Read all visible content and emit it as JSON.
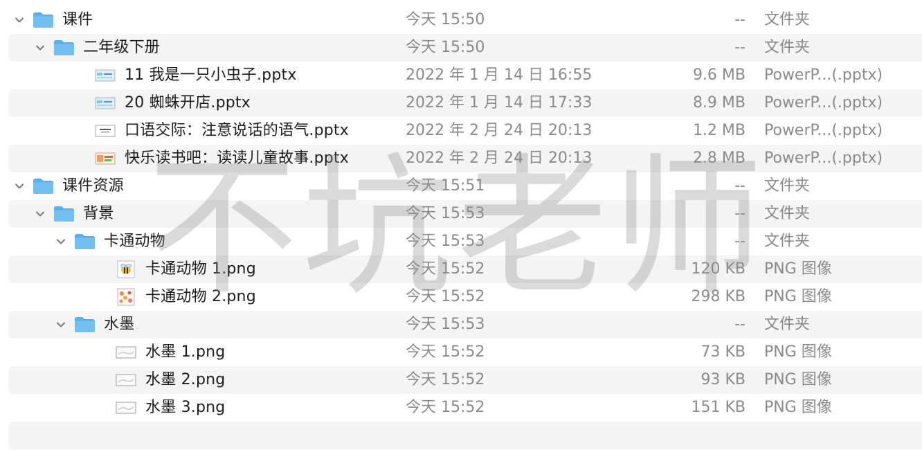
{
  "watermark": "不坑老师",
  "rows": [
    {
      "depth": 0,
      "type": "folder",
      "expanded": true,
      "name": "课件",
      "date": "今天 15:50",
      "size": "--",
      "kind": "文件夹"
    },
    {
      "depth": 1,
      "type": "folder",
      "expanded": true,
      "name": "二年级下册",
      "date": "今天 15:50",
      "size": "--",
      "kind": "文件夹"
    },
    {
      "depth": 2,
      "type": "file",
      "thumb": "pptx-blue",
      "name": "11 我是一只小虫子.pptx",
      "date": "2022 年 1 月 14 日 16:55",
      "size": "9.6 MB",
      "kind": "PowerP...(.pptx)"
    },
    {
      "depth": 2,
      "type": "file",
      "thumb": "pptx-blue",
      "name": "20 蜘蛛开店.pptx",
      "date": "2022 年 1 月 14 日 17:33",
      "size": "8.9 MB",
      "kind": "PowerP...(.pptx)"
    },
    {
      "depth": 2,
      "type": "file",
      "thumb": "pptx-white",
      "name": "口语交际：注意说话的语气.pptx",
      "date": "2022 年 2 月 24 日 20:13",
      "size": "1.2 MB",
      "kind": "PowerP...(.pptx)"
    },
    {
      "depth": 2,
      "type": "file",
      "thumb": "pptx-colorful",
      "name": "快乐读书吧：读读儿童故事.pptx",
      "date": "2022 年 2 月 24 日 20:13",
      "size": "2.8 MB",
      "kind": "PowerP...(.pptx)"
    },
    {
      "depth": 0,
      "type": "folder",
      "expanded": true,
      "name": "课件资源",
      "date": "今天 15:51",
      "size": "--",
      "kind": "文件夹"
    },
    {
      "depth": 1,
      "type": "folder",
      "expanded": true,
      "name": "背景",
      "date": "今天 15:53",
      "size": "--",
      "kind": "文件夹"
    },
    {
      "depth": 2,
      "type": "folder",
      "expanded": true,
      "name": "卡通动物",
      "date": "今天 15:53",
      "size": "--",
      "kind": "文件夹"
    },
    {
      "depth": 3,
      "type": "file",
      "thumb": "png-bee",
      "name": "卡通动物 1.png",
      "date": "今天 15:52",
      "size": "120 KB",
      "kind": "PNG 图像"
    },
    {
      "depth": 3,
      "type": "file",
      "thumb": "png-animals",
      "name": "卡通动物 2.png",
      "date": "今天 15:52",
      "size": "298 KB",
      "kind": "PNG 图像"
    },
    {
      "depth": 2,
      "type": "folder",
      "expanded": true,
      "name": "水墨",
      "date": "今天 15:53",
      "size": "--",
      "kind": "文件夹"
    },
    {
      "depth": 3,
      "type": "file",
      "thumb": "png-ink",
      "name": "水墨 1.png",
      "date": "今天 15:52",
      "size": "73 KB",
      "kind": "PNG 图像"
    },
    {
      "depth": 3,
      "type": "file",
      "thumb": "png-ink",
      "name": "水墨 2.png",
      "date": "今天 15:52",
      "size": "93 KB",
      "kind": "PNG 图像"
    },
    {
      "depth": 3,
      "type": "file",
      "thumb": "png-ink",
      "name": "水墨 3.png",
      "date": "今天 15:52",
      "size": "151 KB",
      "kind": "PNG 图像"
    }
  ]
}
